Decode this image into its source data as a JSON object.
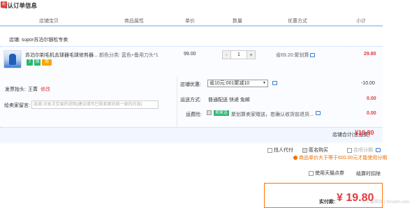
{
  "page_title": "确认订单信息",
  "columns": [
    "店铺宝贝",
    "商品属性",
    "单价",
    "数量",
    "优惠方式",
    "小计"
  ],
  "shop": {
    "icon_text": "超",
    "label": "店铺: supor苏泊尔银松专卖"
  },
  "item": {
    "name": "苏泊尔剃毛机去球器毛球修剪器...",
    "badges": [
      "7",
      "保",
      "券"
    ],
    "spec": "颜色分类: 蓝色+备用刀头*1",
    "price": "99.00",
    "qty": "1",
    "qty_minus": "-",
    "qty_plus": "+",
    "promo": "省69.20:聚划算",
    "subtotal": "29.80"
  },
  "invoice": {
    "label": "发票抬头:",
    "value": "王菁",
    "edit": "修改"
  },
  "note": {
    "label": "给卖家留言:",
    "placeholder": "选填:对本次交易的说明(建议填写已和卖家协商一致的内容)"
  },
  "shop_discount": {
    "label": "店铺优惠:",
    "selected": "省10元:001聚减10",
    "value": "-10.00"
  },
  "shipping": {
    "label": "运送方式:",
    "value": "普通配送 快递 免邮",
    "amount": "0.00"
  },
  "insurance": {
    "label": "运费险:",
    "tag": "卖家送",
    "text": "聚划算卖家赠送，若确认收货前退货...",
    "amount": "0.00"
  },
  "shop_total": {
    "label": "店铺合计(含运费)",
    "value": "¥19.80"
  },
  "options": {
    "proxy_pay": "找人代付",
    "anonymous": "匿名购买",
    "installment": "花呗分期"
  },
  "installment_note": "商品单价大于等于600.00元才能使用分期",
  "tmall_points": "使用天猫点券",
  "settle": "结算时扣除",
  "pay": {
    "label": "实付款:",
    "value": "¥ 19.80"
  },
  "watermark": "什么值得买 | Smzdm.com",
  "colors": {
    "accent_red": "#e4393c",
    "line_blue": "#b2d1ff",
    "pay_orange": "#ff7400"
  }
}
